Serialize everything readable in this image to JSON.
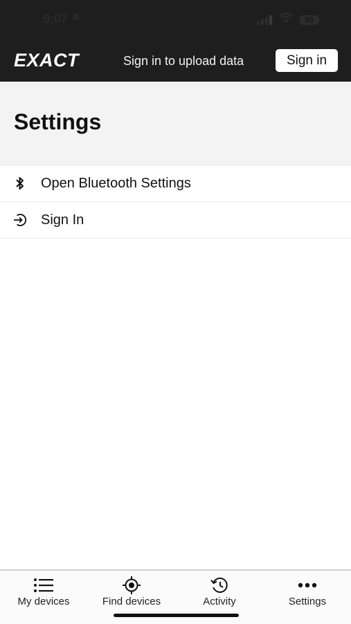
{
  "status_bar": {
    "time": "9:07",
    "battery": "89"
  },
  "header": {
    "logo": "EXACT",
    "upload_text": "Sign in to upload data",
    "sign_in_label": "Sign in"
  },
  "page": {
    "title": "Settings"
  },
  "settings": {
    "items": [
      {
        "label": "Open Bluetooth Settings",
        "icon": "bluetooth-icon"
      },
      {
        "label": "Sign In",
        "icon": "sign-in-icon"
      }
    ]
  },
  "tabs": [
    {
      "label": "My devices",
      "icon": "list-icon"
    },
    {
      "label": "Find devices",
      "icon": "locate-icon"
    },
    {
      "label": "Activity",
      "icon": "history-icon"
    },
    {
      "label": "Settings",
      "icon": "more-icon"
    }
  ]
}
